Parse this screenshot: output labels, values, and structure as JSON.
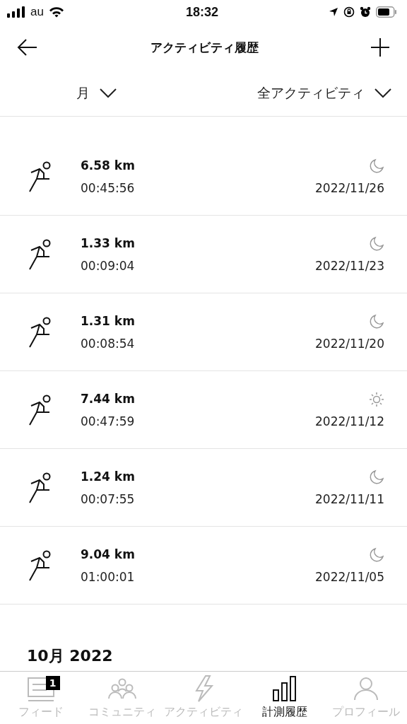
{
  "status_bar": {
    "carrier": "au",
    "time": "18:32"
  },
  "nav": {
    "title": "アクティビティ履歴"
  },
  "filters": [
    {
      "label": "月"
    },
    {
      "label": "全アクティビティ"
    }
  ],
  "activities": [
    {
      "distance": "6.58 km",
      "duration": "00:45:56",
      "date": "2022/11/26",
      "kind": "night"
    },
    {
      "distance": "1.33 km",
      "duration": "00:09:04",
      "date": "2022/11/23",
      "kind": "night"
    },
    {
      "distance": "1.31 km",
      "duration": "00:08:54",
      "date": "2022/11/20",
      "kind": "night"
    },
    {
      "distance": "7.44 km",
      "duration": "00:47:59",
      "date": "2022/11/12",
      "kind": "day"
    },
    {
      "distance": "1.24 km",
      "duration": "00:07:55",
      "date": "2022/11/11",
      "kind": "night"
    },
    {
      "distance": "9.04 km",
      "duration": "01:00:01",
      "date": "2022/11/05",
      "kind": "night"
    }
  ],
  "section_header": "10月 2022",
  "tab_bar": [
    {
      "kind": "feed",
      "label": "フィード",
      "badge": "1",
      "selected": false
    },
    {
      "kind": "community",
      "label": "コミュニティ",
      "selected": false
    },
    {
      "kind": "activity",
      "label": "アクティビティ",
      "selected": false
    },
    {
      "kind": "history",
      "label": "計測履歴",
      "selected": true
    },
    {
      "kind": "profile",
      "label": "プロフィール",
      "selected": false
    }
  ]
}
